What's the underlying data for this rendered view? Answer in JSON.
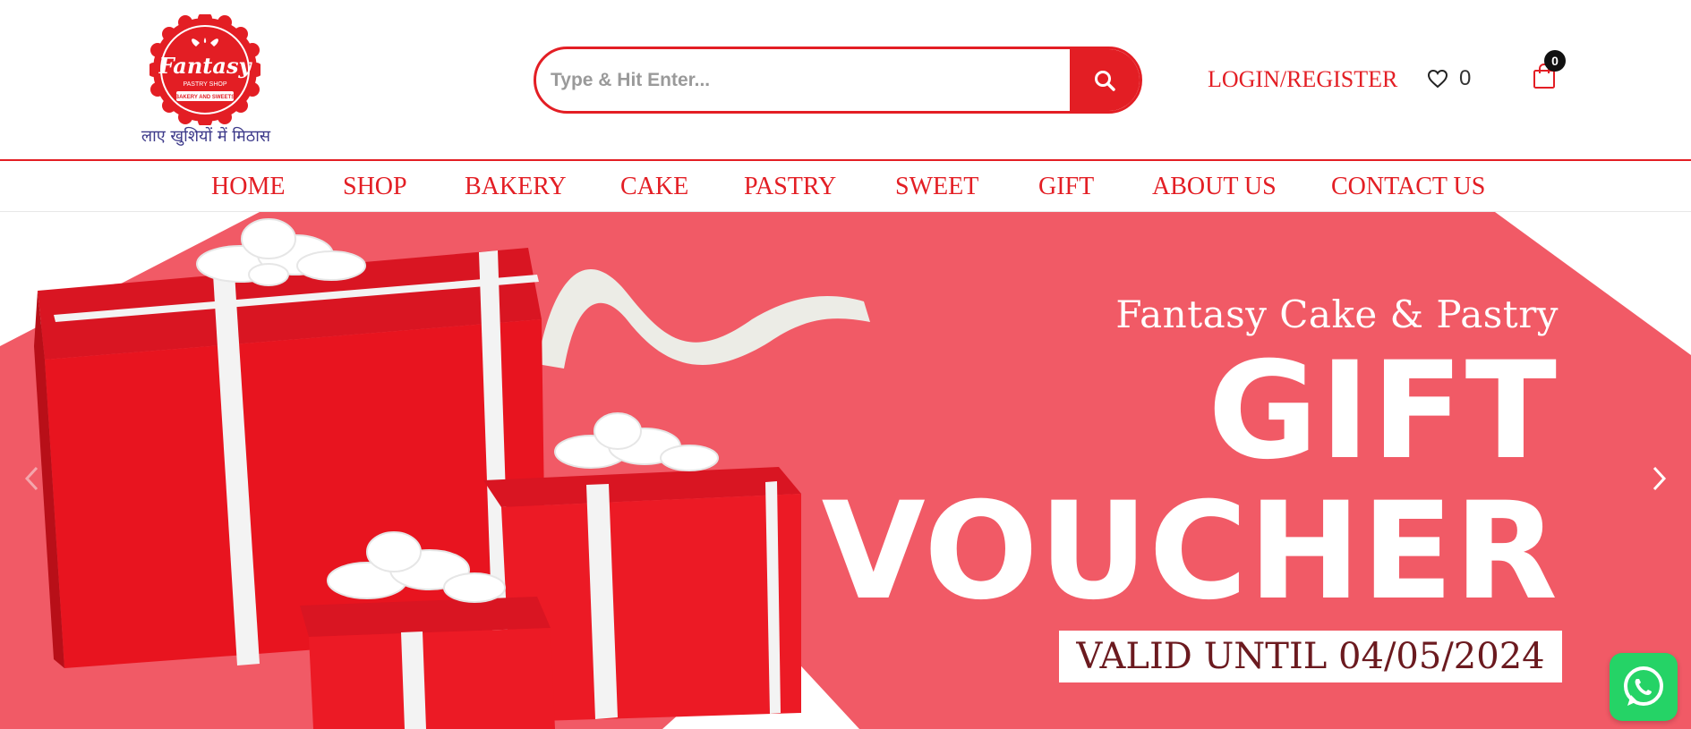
{
  "logo": {
    "brand": "Fantasy",
    "subtitle": "PASTRY SHOP",
    "caption": "BAKERY AND SWEETS",
    "tagline": "लाए खुशियों में मिठास"
  },
  "search": {
    "placeholder": "Type & Hit Enter..."
  },
  "header": {
    "login_label": "LOGIN/REGISTER",
    "wishlist_count": "0",
    "cart_count": "0"
  },
  "nav": {
    "items": [
      {
        "label": "HOME"
      },
      {
        "label": "SHOP"
      },
      {
        "label": "BAKERY"
      },
      {
        "label": "CAKE"
      },
      {
        "label": "PASTRY"
      },
      {
        "label": "SWEET"
      },
      {
        "label": "GIFT"
      },
      {
        "label": "ABOUT US"
      },
      {
        "label": "CONTACT US"
      }
    ]
  },
  "hero": {
    "subtitle": "Fantasy Cake & Pastry",
    "title_line1": "GIFT",
    "title_line2": "VOUCHER",
    "validity": "VALID UNTIL 04/05/2024"
  },
  "icons": {
    "search": "search-icon",
    "wishlist": "heart-icon",
    "cart": "shopping-bag-icon",
    "prev": "chevron-left-icon",
    "next": "chevron-right-icon",
    "chat": "whatsapp-icon"
  },
  "colors": {
    "brand_red": "#e31e24",
    "hero_background": "#f15a66",
    "nav_text": "#e31e24",
    "voucher_text": "#6b1a1f",
    "whatsapp_green": "#25d366"
  }
}
